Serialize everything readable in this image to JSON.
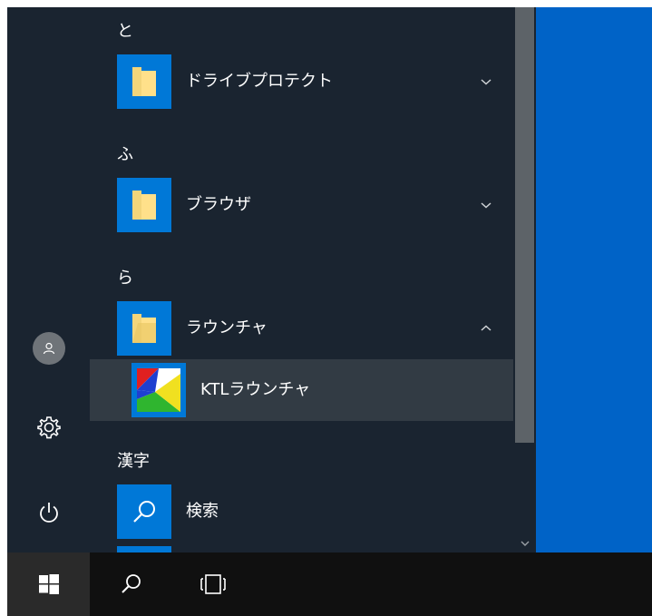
{
  "start_menu": {
    "groups": [
      {
        "letter": "と",
        "app": {
          "label": "ドライブプロテクト",
          "icon": "folder-icon",
          "expanded": false
        }
      },
      {
        "letter": "ふ",
        "app": {
          "label": "ブラウザ",
          "icon": "folder-icon",
          "expanded": false
        }
      },
      {
        "letter": "ら",
        "app": {
          "label": "ラウンチャ",
          "icon": "folder-icon",
          "expanded": true
        },
        "children": [
          {
            "label": "KTLラウンチャ",
            "icon": "ktl-launcher-icon"
          }
        ]
      },
      {
        "letter": "漢字",
        "app": {
          "label": "検索",
          "icon": "search-icon"
        }
      }
    ],
    "rail": [
      "user-icon",
      "settings-gear-icon",
      "power-icon"
    ]
  },
  "taskbar": {
    "buttons": [
      "windows-logo-icon",
      "search-icon",
      "task-view-icon"
    ]
  },
  "colors": {
    "menu_bg": "#1a2430",
    "tile_blue": "#0078d7",
    "desktop_blue": "#0063c7",
    "highlight_row": "#323b44",
    "taskbar_bg": "#101010",
    "scrollbar": "#5d6368"
  }
}
